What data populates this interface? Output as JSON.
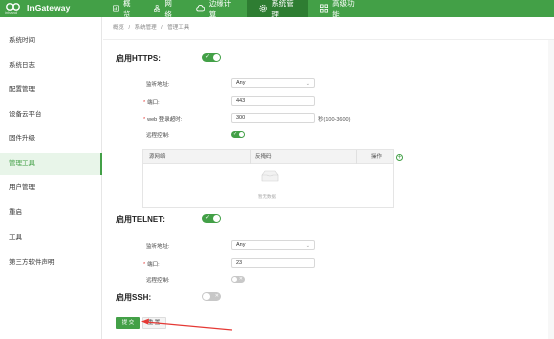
{
  "brand": {
    "name": "InGateway",
    "sub": "inhand"
  },
  "nav": [
    {
      "label": "概览",
      "icon": "dashboard-icon",
      "active": false
    },
    {
      "label": "网络",
      "icon": "network-icon",
      "active": false
    },
    {
      "label": "边缘计算",
      "icon": "cloud-icon",
      "active": false
    },
    {
      "label": "系统管理",
      "icon": "gear-icon",
      "active": true
    },
    {
      "label": "高级功能",
      "icon": "grid-icon",
      "active": false
    }
  ],
  "sidebar": {
    "items": [
      {
        "label": "系统时间"
      },
      {
        "label": "系统日志"
      },
      {
        "label": "配置管理"
      },
      {
        "label": "设备云平台"
      },
      {
        "label": "固件升级"
      },
      {
        "label": "管理工具"
      },
      {
        "label": "用户管理"
      },
      {
        "label": "重启"
      },
      {
        "label": "工具"
      },
      {
        "label": "第三方软件声明"
      }
    ],
    "active_index": 5
  },
  "breadcrumb": {
    "items": [
      "概览",
      "/",
      "系统管理",
      "/",
      "管理工具"
    ]
  },
  "https": {
    "title": "启用HTTPS:",
    "enabled": true,
    "listen_label": "监听地址:",
    "listen_value": "Any",
    "port_label": "端口:",
    "port_value": "443",
    "timeout_label": "web 登录超时:",
    "timeout_value": "300",
    "timeout_suffix": "秒(100-3600)",
    "remote_label": "远程控制:",
    "remote_enabled": true,
    "table": {
      "columns": [
        "源网络",
        "反掩码",
        "操作"
      ],
      "empty_text": "暂无数据"
    }
  },
  "telnet": {
    "title": "启用TELNET:",
    "enabled": true,
    "listen_label": "监听地址:",
    "listen_value": "Any",
    "port_label": "端口:",
    "port_value": "23",
    "remote_label": "远程控制:",
    "remote_enabled": false
  },
  "ssh": {
    "title": "启用SSH:",
    "enabled": false
  },
  "actions": {
    "submit_label": "提 交",
    "reset_label": "重 置"
  },
  "colors": {
    "accent": "#43a047",
    "accent_dark": "#2e7d32",
    "annotation": "#e53935"
  }
}
